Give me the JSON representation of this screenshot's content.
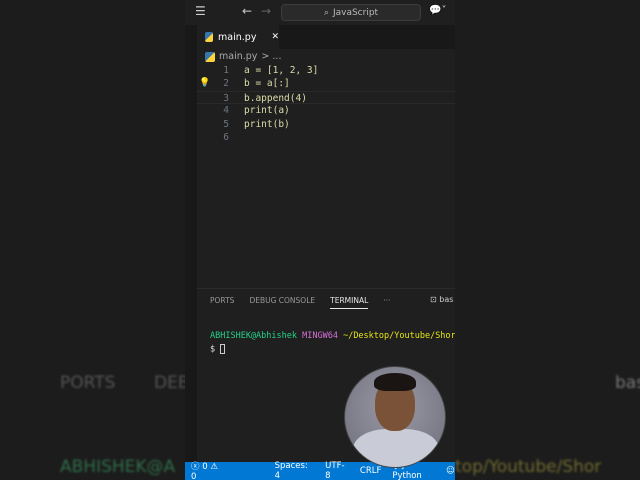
{
  "titlebar": {
    "search": "JavaScript"
  },
  "tab": {
    "label": "main.py"
  },
  "breadcrumb": {
    "file": "main.py",
    "rest": "> ..."
  },
  "code": [
    {
      "n": "1",
      "text": "a = [1, 2, 3]"
    },
    {
      "n": "2",
      "text": "b = a[:]"
    },
    {
      "n": "3",
      "text": "b.append(4)"
    },
    {
      "n": "4",
      "text": "print(a)"
    },
    {
      "n": "5",
      "text": "print(b)"
    },
    {
      "n": "6",
      "text": ""
    }
  ],
  "panel": {
    "tabs": [
      "PORTS",
      "DEBUG CONSOLE",
      "TERMINAL",
      "···"
    ],
    "shell": "bas"
  },
  "terminal": {
    "user": "ABHISHEK@Abhishek",
    "env": "MINGW64",
    "path": "~/Desktop/Youtube/Shorts",
    "prompt": "$"
  },
  "status": {
    "errors": "0",
    "warnings": "0",
    "spaces": "Spaces: 4",
    "encoding": "UTF-8",
    "eol": "CRLF",
    "language": "Python"
  },
  "background": {
    "ports": "PORTS",
    "debug": "DEBU",
    "bash": "bas",
    "user": "ABHISHEK@A",
    "path": "top/Youtube/Shor"
  }
}
